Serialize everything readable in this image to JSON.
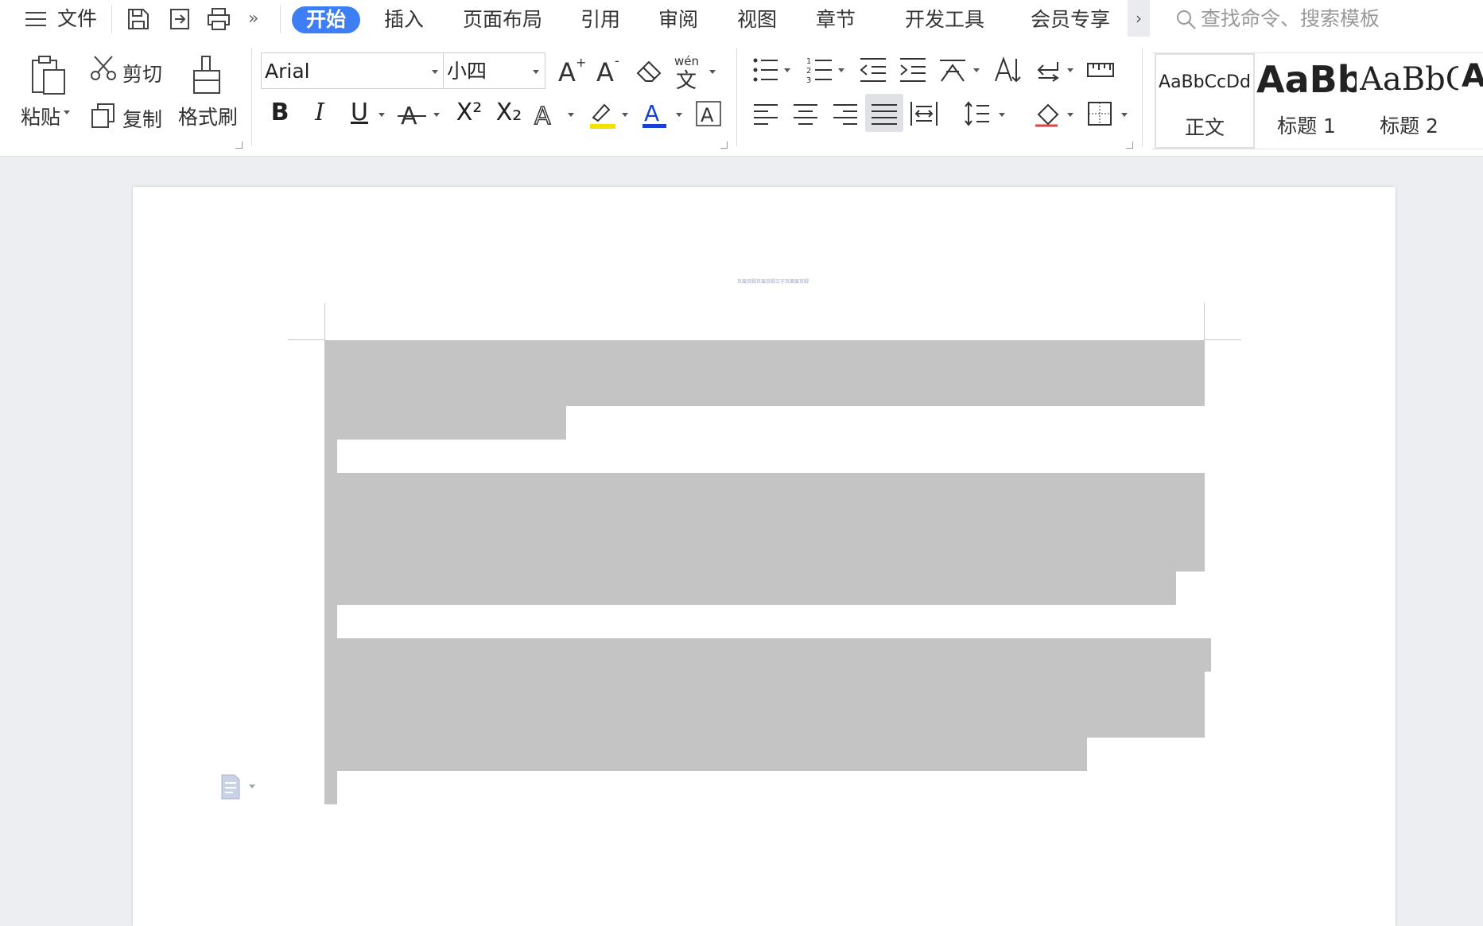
{
  "menubar": {
    "file_label": "文件",
    "tabs": [
      "开始",
      "插入",
      "页面布局",
      "引用",
      "审阅",
      "视图",
      "章节",
      "开发工具",
      "会员专享"
    ],
    "search_placeholder": "查找命令、搜索模板"
  },
  "ribbon": {
    "clipboard": {
      "paste": "粘贴",
      "cut": "剪切",
      "copy": "复制",
      "format_painter": "格式刷"
    },
    "font": {
      "family": "Arial",
      "size": "小四",
      "bold": "B",
      "italic": "I",
      "underline": "U",
      "superscript": "X²",
      "subscript": "X₂",
      "pinyin": "wén"
    },
    "styles": [
      {
        "sample": "AaBbCcDd",
        "name": "正文"
      },
      {
        "sample": "AaBb",
        "name": "标题 1"
      },
      {
        "sample": "AaBbC",
        "name": "标题 2"
      },
      {
        "sample": "A",
        "name": ""
      }
    ]
  },
  "document": {
    "header_text": "页眉页脚页眉页脚文字页面眉页脚"
  },
  "colors": {
    "accent": "#3d7ef5",
    "highlight": "#f5e100",
    "font_color": "#1a3fd6",
    "redaction": "#c4c4c4"
  }
}
